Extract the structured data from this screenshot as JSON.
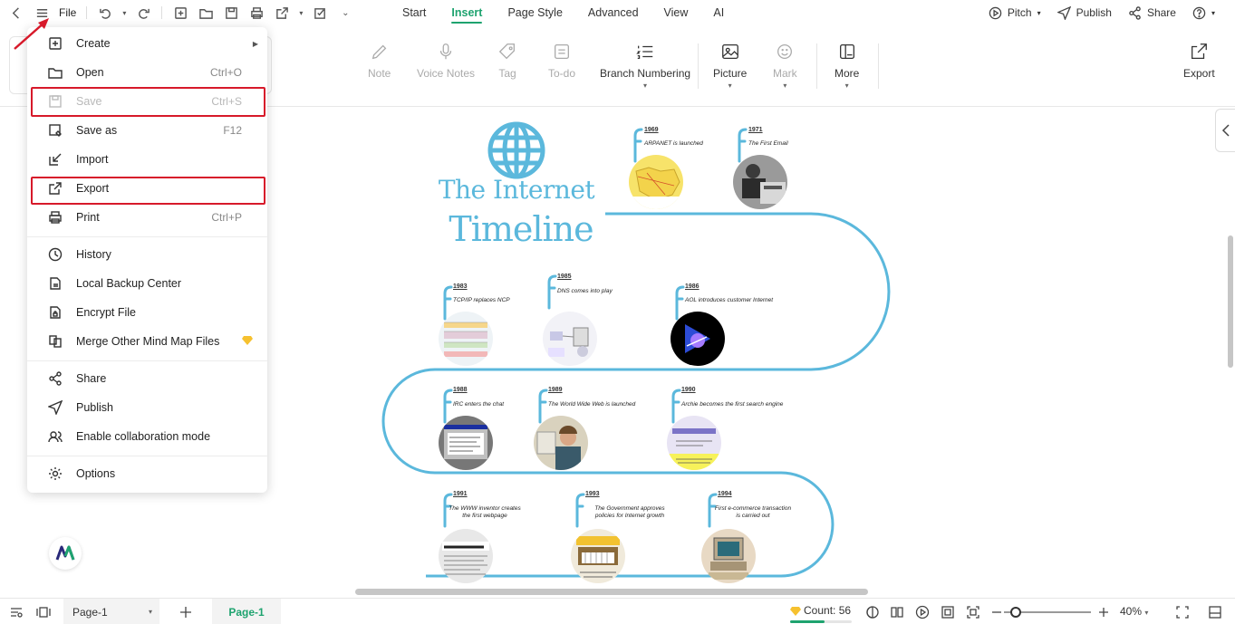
{
  "titlebar": {
    "file_label": "File",
    "tabs": [
      {
        "label": "Start",
        "active": false
      },
      {
        "label": "Insert",
        "active": true
      },
      {
        "label": "Page Style",
        "active": false
      },
      {
        "label": "Advanced",
        "active": false
      },
      {
        "label": "View",
        "active": false
      },
      {
        "label": "AI",
        "active": false
      }
    ],
    "actions": {
      "pitch": "Pitch",
      "publish": "Publish",
      "share": "Share"
    }
  },
  "ribbon": {
    "note": "Note",
    "voice_notes": "Voice Notes",
    "tag": "Tag",
    "todo": "To-do",
    "branch_numbering": "Branch Numbering",
    "picture": "Picture",
    "mark": "Mark",
    "more": "More",
    "export": "Export"
  },
  "file_menu": {
    "items": [
      {
        "label": "Create",
        "shortcut": "",
        "submenu": true
      },
      {
        "label": "Open",
        "shortcut": "Ctrl+O"
      },
      {
        "label": "Save",
        "shortcut": "Ctrl+S",
        "disabled": true
      },
      {
        "label": "Save as",
        "shortcut": "F12"
      },
      {
        "label": "Import",
        "shortcut": ""
      },
      {
        "label": "Export",
        "shortcut": ""
      },
      {
        "label": "Print",
        "shortcut": "Ctrl+P"
      },
      {
        "label": "History",
        "shortcut": ""
      },
      {
        "label": "Local Backup Center",
        "shortcut": ""
      },
      {
        "label": "Encrypt File",
        "shortcut": ""
      },
      {
        "label": "Merge Other Mind Map Files",
        "shortcut": "",
        "premium": true
      },
      {
        "label": "Share",
        "shortcut": ""
      },
      {
        "label": "Publish",
        "shortcut": ""
      },
      {
        "label": "Enable collaboration mode",
        "shortcut": ""
      },
      {
        "label": "Options",
        "shortcut": ""
      }
    ]
  },
  "canvas": {
    "title_line1": "The Internet",
    "title_line2": "Timeline",
    "events": [
      {
        "year": "1969",
        "text": "ARPANET is launched"
      },
      {
        "year": "1971",
        "text": "The First Email"
      },
      {
        "year": "1983",
        "text": "TCP/IP replaces NCP"
      },
      {
        "year": "1985",
        "text": "DNS comes into play"
      },
      {
        "year": "1986",
        "text": "AOL introduces customer Internet"
      },
      {
        "year": "1988",
        "text": "IRC enters the chat"
      },
      {
        "year": "1989",
        "text": "The World Wide Web is launched"
      },
      {
        "year": "1990",
        "text": "Archie becomes the first search engine"
      },
      {
        "year": "1991",
        "text": "The WWW inventor creates the first webpage"
      },
      {
        "year": "1993",
        "text": "The Government approves policies for Internet growth"
      },
      {
        "year": "1994",
        "text": "First e-commerce transaction is carried out"
      }
    ],
    "colors": {
      "accent": "#5bb8dc",
      "brand": "#1ea36f",
      "highlight": "#d7192a"
    }
  },
  "statusbar": {
    "page_select": "Page-1",
    "page_tab": "Page-1",
    "count": "Count: 56",
    "count_fill": 0.56,
    "zoom": "40%"
  }
}
